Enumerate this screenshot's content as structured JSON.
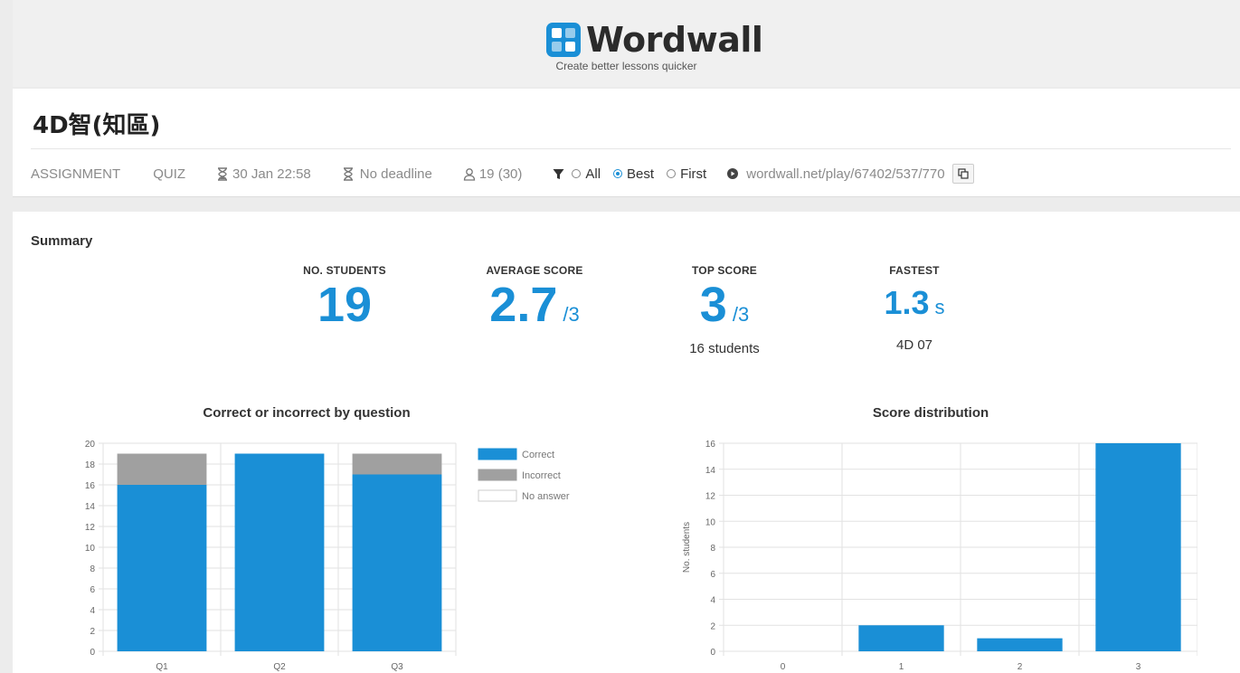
{
  "brand": {
    "name": "Wordwall",
    "tagline": "Create better lessons quicker",
    "accent": "#1a8fd6"
  },
  "header": {
    "title": "4D智(知區)",
    "meta": {
      "assignment": "ASSIGNMENT",
      "activity_type": "QUIZ",
      "start_time": "30 Jan 22:58",
      "deadline": "No deadline",
      "students": "19 (30)",
      "filter_options": [
        {
          "label": "All",
          "selected": false
        },
        {
          "label": "Best",
          "selected": true
        },
        {
          "label": "First",
          "selected": false
        }
      ],
      "link": "wordwall.net/play/67402/537/770",
      "icons": [
        "hourglass-icon",
        "hourglass-empty-icon",
        "user-icon",
        "filter-icon",
        "link-icon",
        "copy-icon"
      ]
    }
  },
  "summary": {
    "title": "Summary",
    "no_students": {
      "label": "NO. STUDENTS",
      "value": "19"
    },
    "average_score": {
      "label": "AVERAGE SCORE",
      "value": "2.7",
      "unit": "/3"
    },
    "top_score": {
      "label": "TOP SCORE",
      "value": "3",
      "unit": "/3",
      "sub": "16 students"
    },
    "fastest": {
      "label": "FASTEST",
      "value": "1.3",
      "unit": "s",
      "sub": "4D 07"
    }
  },
  "chart_data": [
    {
      "type": "bar",
      "stacked": true,
      "title": "Correct or incorrect by question",
      "categories": [
        "Q1",
        "Q2",
        "Q3"
      ],
      "series": [
        {
          "name": "Correct",
          "values": [
            16,
            19,
            17
          ],
          "color": "#1a8fd6"
        },
        {
          "name": "Incorrect",
          "values": [
            3,
            0,
            2
          ],
          "color": "#a0a0a0"
        },
        {
          "name": "No answer",
          "values": [
            0,
            0,
            0
          ],
          "color": "#ffffff"
        }
      ],
      "ylim": [
        0,
        20
      ],
      "yticks": [
        "0",
        "2",
        "4",
        "6",
        "8",
        "10",
        "12",
        "14",
        "16",
        "18",
        "20"
      ],
      "legend": "top-right",
      "grid": true
    },
    {
      "type": "bar",
      "title": "Score distribution",
      "categories": [
        "0",
        "1",
        "2",
        "3"
      ],
      "values": [
        0,
        2,
        1,
        16
      ],
      "color": "#1a8fd6",
      "ylabel": "No. students",
      "ylim": [
        0,
        16
      ],
      "yticks": [
        "0",
        "2",
        "4",
        "6",
        "8",
        "10",
        "12",
        "14",
        "16"
      ],
      "grid": true
    }
  ]
}
